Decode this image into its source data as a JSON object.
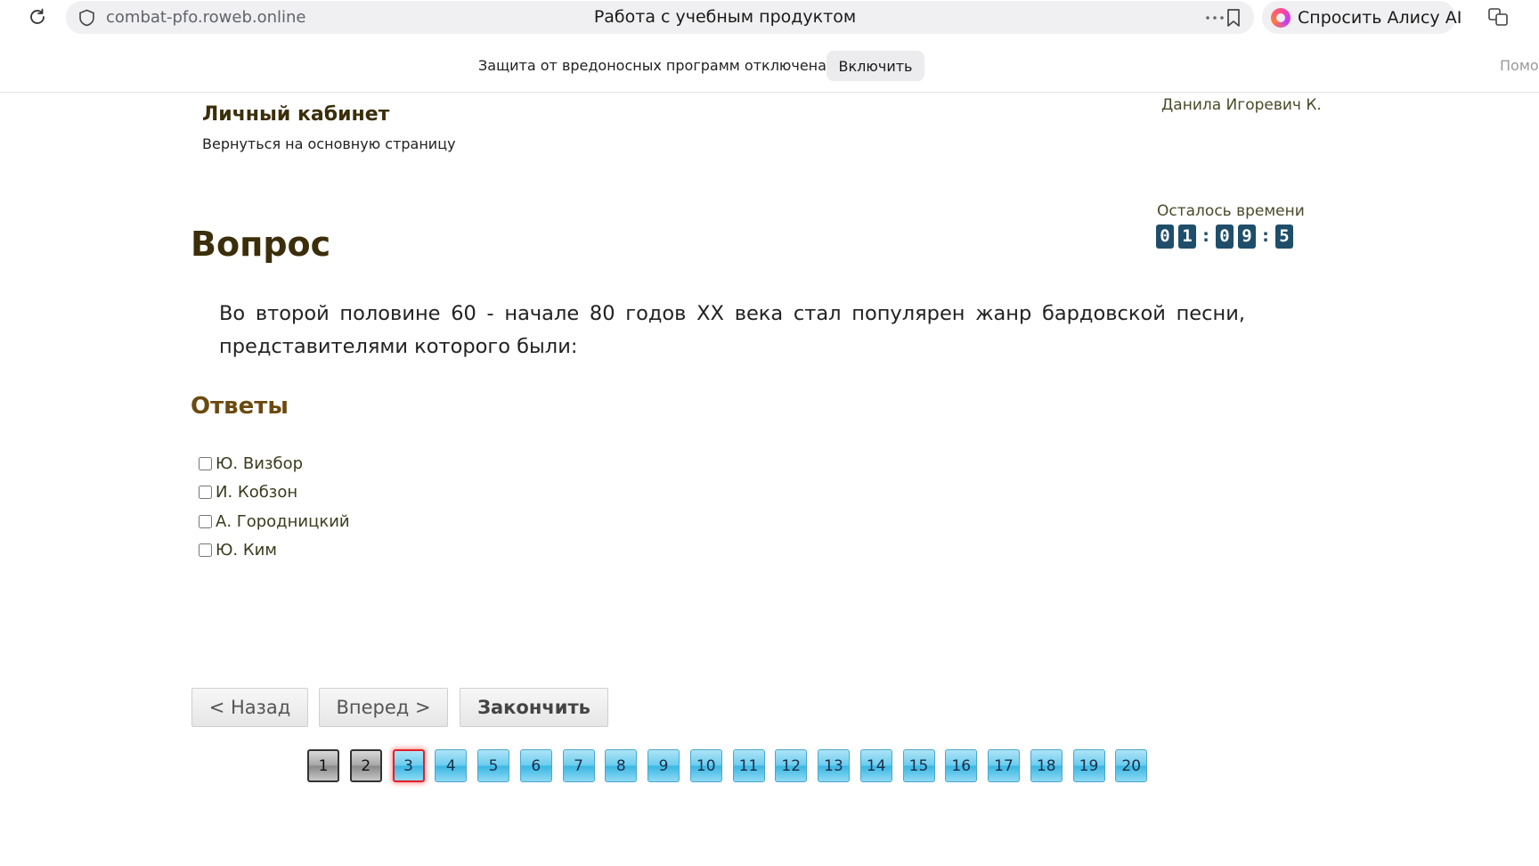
{
  "browser": {
    "url": "combat-pfo.roweb.online",
    "title": "Работа с учебным продуктом",
    "alice_label": "Спросить Алису AI"
  },
  "protection": {
    "message": "Защита от вредоносных программ отключена",
    "enable_label": "Включить",
    "help_label": "Помо"
  },
  "header": {
    "cabinet_title": "Личный кабинет",
    "back_link": "Вернуться на основную страницу",
    "user_name": "Данила Игоревич К."
  },
  "timer": {
    "label": "Осталось времени",
    "digits": [
      "0",
      "1",
      "0",
      "9",
      "5"
    ]
  },
  "question": {
    "heading": "Вопрос",
    "text": "Во второй половине 60 - начале 80 годов XX века стал популярен жанр бардовской песни, представителями которого были:"
  },
  "answers": {
    "heading": "Ответы",
    "items": [
      {
        "label": "Ю. Визбор",
        "checked": false
      },
      {
        "label": "И. Кобзон",
        "checked": false
      },
      {
        "label": "А. Городницкий",
        "checked": false
      },
      {
        "label": "Ю. Ким",
        "checked": false
      }
    ]
  },
  "navigation": {
    "back_label": "< Назад",
    "forward_label": "Вперед >",
    "finish_label": "Закончить"
  },
  "pages": {
    "numbers": [
      "1",
      "2",
      "3",
      "4",
      "5",
      "6",
      "7",
      "8",
      "9",
      "10",
      "11",
      "12",
      "13",
      "14",
      "15",
      "16",
      "17",
      "18",
      "19",
      "20"
    ],
    "done": [
      "1",
      "2"
    ],
    "current": "3"
  },
  "colors": {
    "heading": "#3b2e0a",
    "answers_heading": "#6b4a10",
    "timer_digit_bg": "#1f4e6b",
    "page_current_border": "#e0202a"
  }
}
